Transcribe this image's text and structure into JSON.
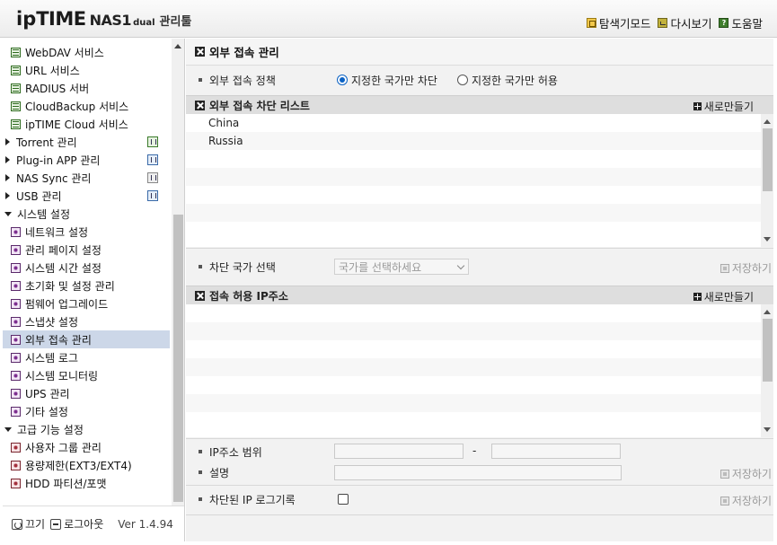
{
  "header": {
    "logo_ip": "ip",
    "logo_time": "TIME",
    "logo_nas": "NAS1",
    "logo_dual": "dual",
    "logo_manager": "관리툴",
    "links": [
      {
        "label": "탐색기모드",
        "icon": "explorer-icon"
      },
      {
        "label": "다시보기",
        "icon": "refresh-icon"
      },
      {
        "label": "도움말",
        "icon": "help-icon"
      }
    ]
  },
  "sidebar": {
    "items": [
      {
        "label": "WebDAV 서비스",
        "icon": "green"
      },
      {
        "label": "URL 서비스",
        "icon": "green"
      },
      {
        "label": "RADIUS 서버",
        "icon": "green"
      },
      {
        "label": "CloudBackup 서비스",
        "icon": "green"
      },
      {
        "label": "ipTIME Cloud 서비스",
        "icon": "green"
      },
      {
        "label": "Torrent 관리",
        "group": "collapsed"
      },
      {
        "label": "Plug-in APP 관리",
        "group": "collapsed"
      },
      {
        "label": "NAS Sync 관리",
        "group": "collapsed"
      },
      {
        "label": "USB 관리",
        "group": "collapsed"
      },
      {
        "label": "시스템 설정",
        "group": "expanded"
      },
      {
        "label": "네트워크 설정",
        "icon": "purple"
      },
      {
        "label": "관리 페이지 설정",
        "icon": "purple"
      },
      {
        "label": "시스템 시간 설정",
        "icon": "purple"
      },
      {
        "label": "초기화 및 설정 관리",
        "icon": "purple"
      },
      {
        "label": "펌웨어 업그레이드",
        "icon": "purple"
      },
      {
        "label": "스냅샷 설정",
        "icon": "purple"
      },
      {
        "label": "외부 접속 관리",
        "icon": "purple",
        "selected": true
      },
      {
        "label": "시스템 로그",
        "icon": "purple"
      },
      {
        "label": "시스템 모니터링",
        "icon": "purple"
      },
      {
        "label": "UPS 관리",
        "icon": "purple"
      },
      {
        "label": "기타 설정",
        "icon": "purple"
      },
      {
        "label": "고급 기능 설정",
        "group": "expanded"
      },
      {
        "label": "사용자 그룹 관리",
        "icon": "red"
      },
      {
        "label": "용량제한(EXT3/EXT4)",
        "icon": "red"
      },
      {
        "label": "HDD 파티션/포맷",
        "icon": "red"
      }
    ],
    "footer": {
      "power_label": "끄기",
      "logout_label": "로그아웃",
      "version": "Ver 1.4.94"
    }
  },
  "main": {
    "title": "외부 접속 관리",
    "policy": {
      "label": "외부 접속 정책",
      "option_block": "지정한 국가만 차단",
      "option_allow": "지정한 국가만 허용",
      "selected": "block"
    },
    "block_list": {
      "title": "외부 접속 차단 리스트",
      "new_label": "새로만들기",
      "rows": [
        "China",
        "Russia"
      ]
    },
    "country_select": {
      "label": "차단 국가 선택",
      "placeholder": "국가를 선택하세요",
      "save_label": "저장하기"
    },
    "allow_ip": {
      "title": "접속 허용 IP주소",
      "new_label": "새로만들기"
    },
    "ip_range": {
      "label": "IP주소 범위",
      "separator": "-"
    },
    "description": {
      "label": "설명",
      "save_label": "저장하기"
    },
    "blocked_log": {
      "label": "차단된 IP 로그기록",
      "save_label": "저장하기"
    }
  }
}
